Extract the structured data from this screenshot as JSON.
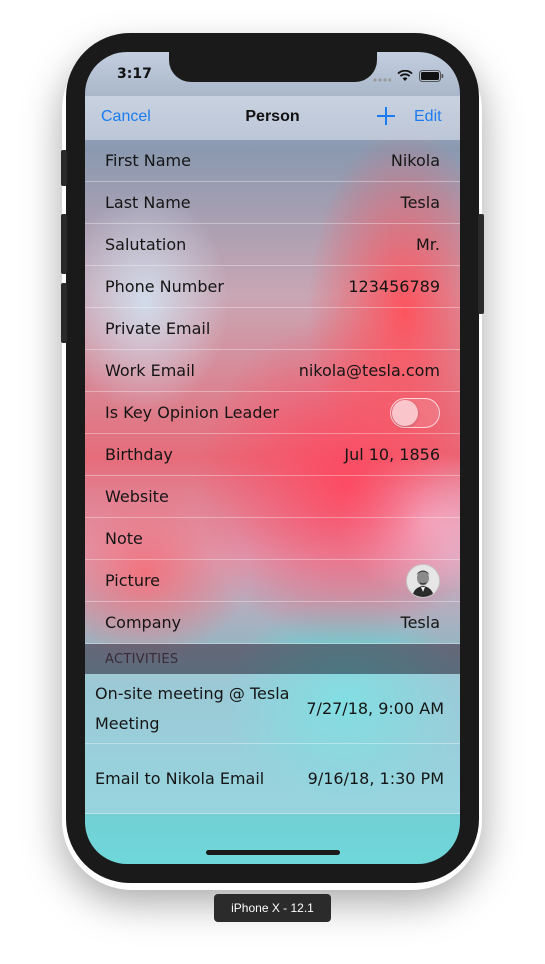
{
  "status_bar": {
    "time": "3:17"
  },
  "navbar": {
    "cancel_label": "Cancel",
    "title": "Person",
    "add_icon": "plus-icon",
    "edit_label": "Edit"
  },
  "fields": [
    {
      "label": "First Name",
      "value": "Nikola"
    },
    {
      "label": "Last Name",
      "value": "Tesla"
    },
    {
      "label": "Salutation",
      "value": "Mr."
    },
    {
      "label": "Phone Number",
      "value": "123456789"
    },
    {
      "label": "Private Email",
      "value": ""
    },
    {
      "label": "Work Email",
      "value": "nikola@tesla.com"
    },
    {
      "label": "Is Key Opinion Leader",
      "value": "",
      "toggle_on": false
    },
    {
      "label": "Birthday",
      "value": "Jul 10, 1856"
    },
    {
      "label": "Website",
      "value": ""
    },
    {
      "label": "Note",
      "value": ""
    },
    {
      "label": "Picture",
      "value": ""
    },
    {
      "label": "Company",
      "value": "Tesla"
    }
  ],
  "activities": {
    "header": "ACTIVITIES",
    "items": [
      {
        "title": "On-site meeting @ Tesla Meeting",
        "date": "7/27/18, 9:00 AM"
      },
      {
        "title": "Email to Nikola Email",
        "date": "9/16/18, 1:30 PM"
      }
    ]
  },
  "device_label": "iPhone X - 12.1",
  "colors": {
    "accent": "#1a7cf0"
  }
}
